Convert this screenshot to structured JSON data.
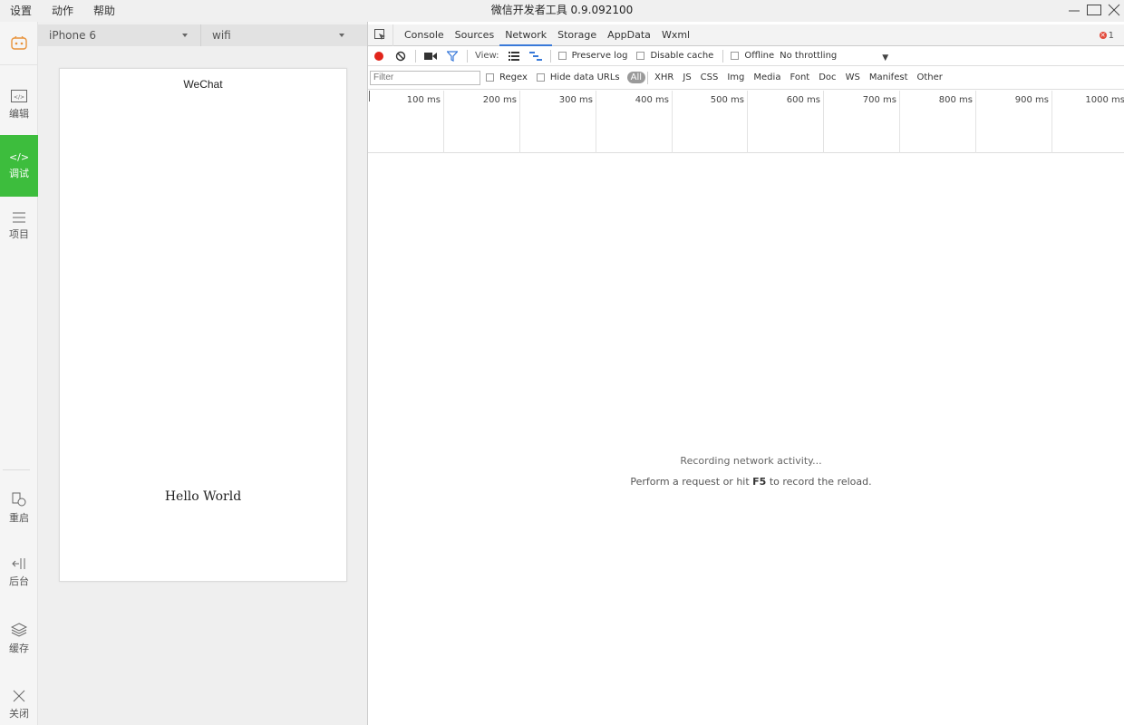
{
  "menu": [
    "设置",
    "动作",
    "帮助"
  ],
  "window_title": "微信开发者工具 0.9.092100",
  "sidebar": {
    "top_items": [
      {
        "label": "编辑",
        "icon": "code-window-icon"
      },
      {
        "label": "调试",
        "icon": "code-brackets-icon",
        "active": true
      },
      {
        "label": "项目",
        "icon": "menu-lines-icon"
      }
    ],
    "bottom_items": [
      {
        "label": "重启",
        "icon": "restart-icon"
      },
      {
        "label": "后台",
        "icon": "background-icon"
      },
      {
        "label": "缓存",
        "icon": "layers-icon"
      },
      {
        "label": "关闭",
        "icon": "close-icon"
      }
    ]
  },
  "simulator": {
    "device": "iPhone 6",
    "network": "wifi",
    "nav_title": "WeChat",
    "body_text": "Hello World"
  },
  "devtools": {
    "tabs": [
      "Console",
      "Sources",
      "Network",
      "Storage",
      "AppData",
      "Wxml"
    ],
    "active_tab": "Network",
    "error_count": "1",
    "toolbar": {
      "view_label": "View:",
      "preserve_log": "Preserve log",
      "disable_cache": "Disable cache",
      "offline": "Offline",
      "throttling": "No throttling"
    },
    "filter": {
      "placeholder": "Filter",
      "regex": "Regex",
      "hide_data_urls": "Hide data URLs",
      "types": [
        "All",
        "XHR",
        "JS",
        "CSS",
        "Img",
        "Media",
        "Font",
        "Doc",
        "WS",
        "Manifest",
        "Other"
      ]
    },
    "timeline_ticks": [
      "100 ms",
      "200 ms",
      "300 ms",
      "400 ms",
      "500 ms",
      "600 ms",
      "700 ms",
      "800 ms",
      "900 ms",
      "1000 ms"
    ],
    "empty": {
      "line1": "Recording network activity...",
      "line2_before": "Perform a request or hit ",
      "line2_key": "F5",
      "line2_after": " to record the reload."
    }
  },
  "colors": {
    "sidebar_active": "#3dbd3d",
    "record_red": "#e1251b",
    "filter_blue": "#3879d9"
  }
}
